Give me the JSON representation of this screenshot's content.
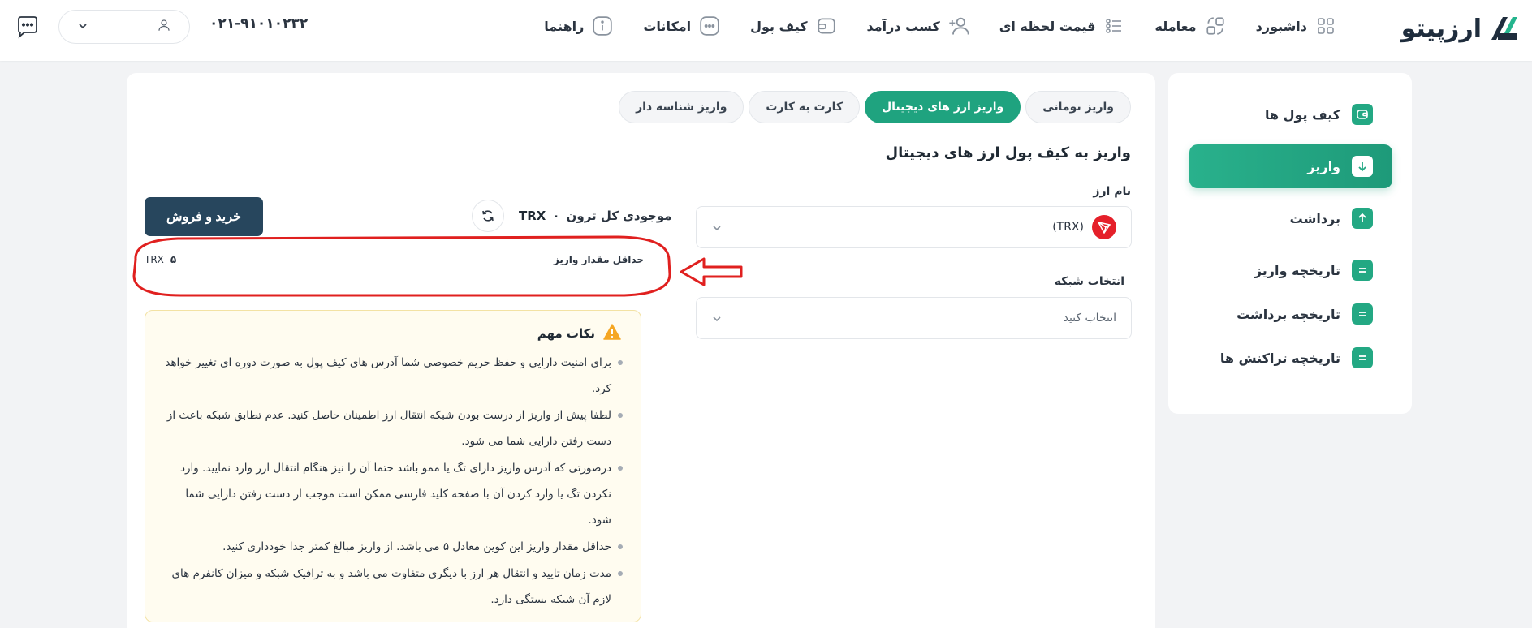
{
  "header": {
    "logo_text": "ارزپیتو",
    "nav": [
      {
        "label": "داشبورد",
        "icon": "grid-icon"
      },
      {
        "label": "معامله",
        "icon": "exchange-icon"
      },
      {
        "label": "قیمت لحظه ای",
        "icon": "price-list-icon"
      },
      {
        "label": "کسب درآمد",
        "icon": "add-user-icon"
      },
      {
        "label": "کیف پول",
        "icon": "wallet-icon"
      },
      {
        "label": "امکانات",
        "icon": "more-icon"
      },
      {
        "label": "راهنما",
        "icon": "info-icon"
      }
    ],
    "phone": "۰۲۱-۹۱۰۱۰۲۳۲"
  },
  "sidebar": {
    "items": [
      {
        "label": "کیف پول ها",
        "icon": "wallet-icon",
        "active": false
      },
      {
        "label": "واریز",
        "icon": "arrow-down-icon",
        "active": true
      },
      {
        "label": "برداشت",
        "icon": "arrow-up-icon",
        "active": false
      },
      {
        "label": "تاریخچه واریز",
        "icon": "list-icon",
        "active": false
      },
      {
        "label": "تاریخچه برداشت",
        "icon": "list-icon",
        "active": false
      },
      {
        "label": "تاریخچه تراکنش ها",
        "icon": "list-icon",
        "active": false
      }
    ]
  },
  "tabs": [
    {
      "label": "واریز تومانی",
      "active": false
    },
    {
      "label": "واریز ارز های دیجیتال",
      "active": true
    },
    {
      "label": "کارت به کارت",
      "active": false
    },
    {
      "label": "واریز شناسه دار",
      "active": false
    }
  ],
  "main": {
    "title": "واریز به کیف پول ارز های دیجیتال",
    "currency_label": "نام ارز",
    "currency_value": "(TRX)",
    "network_label": "انتخاب شبکه",
    "network_placeholder": "انتخاب کنید",
    "balance_label": "موجودی کل ترون",
    "balance_amount": "۰",
    "balance_unit": "TRX",
    "buy_sell_button": "خرید و فروش",
    "min_deposit_label": "حداقل مقدار واریز",
    "min_deposit_amount": "۵",
    "min_deposit_unit": "TRX"
  },
  "notes": {
    "title": "نکات مهم",
    "items": [
      "برای امنیت دارایی و حفظ حریم خصوصی شما آدرس های کیف پول به صورت دوره ای تغییر خواهد کرد.",
      "لطفا پیش از واریز از درست بودن شبکه انتقال ارز اطمینان حاصل کنید. عدم تطابق شبکه باعث از دست رفتن دارایی شما می شود.",
      "درصورتی که آدرس واریز دارای تگ یا ممو باشد حتما آن را نیز هنگام انتقال ارز وارد نمایید. وارد نکردن تگ یا وارد کردن آن با صفحه کلید فارسی ممکن است موجب از دست رفتن دارایی شما شود.",
      "حداقل مقدار واریز این کوین معادل ۵ می باشد. از واریز مبالغ کمتر جدا خودداری کنید.",
      "مدت زمان تایید و انتقال هر ارز با دیگری متفاوت می باشد و به ترافیک شبکه و میزان کانفرم های لازم آن شبکه بستگی دارد."
    ]
  },
  "colors": {
    "accent": "#1fa37f",
    "dark_button": "#27465d",
    "trx_red": "#e5202a",
    "annotation_red": "#e0201f",
    "notes_bg": "#fffcf0"
  }
}
